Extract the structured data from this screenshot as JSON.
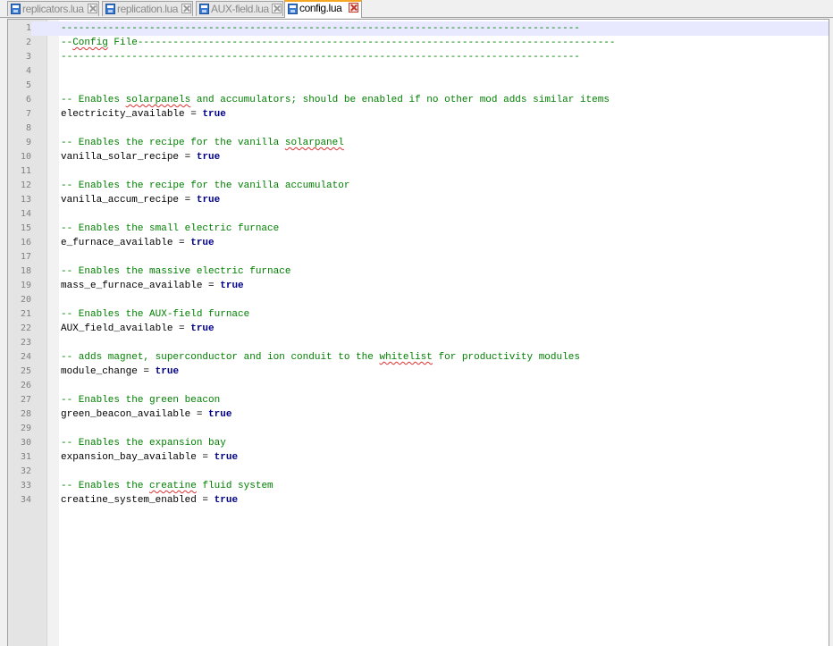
{
  "tabs": [
    {
      "label": "replicators.lua",
      "active": false
    },
    {
      "label": "replication.lua",
      "active": false
    },
    {
      "label": "AUX-field.lua",
      "active": false
    },
    {
      "label": "config.lua",
      "active": true
    }
  ],
  "editor": {
    "current_line": 1,
    "lines": [
      {
        "n": "1",
        "type": "comment",
        "text": "----------------------------------------------------------------------------------------"
      },
      {
        "n": "2",
        "type": "comment",
        "pre": "--",
        "spell": "Config",
        "post": " File---------------------------------------------------------------------------------"
      },
      {
        "n": "3",
        "type": "comment",
        "text": "----------------------------------------------------------------------------------------"
      },
      {
        "n": "4",
        "type": "blank"
      },
      {
        "n": "5",
        "type": "blank"
      },
      {
        "n": "6",
        "type": "comment",
        "pre": "-- Enables ",
        "spell": "solarpanels",
        "post": " and accumulators; should be enabled if no other mod adds similar items"
      },
      {
        "n": "7",
        "type": "assign",
        "name": "electricity_available",
        "op": " = ",
        "value": "true"
      },
      {
        "n": "8",
        "type": "blank"
      },
      {
        "n": "9",
        "type": "comment",
        "pre": "-- Enables the recipe for the vanilla ",
        "spell": "solarpanel",
        "post": ""
      },
      {
        "n": "10",
        "type": "assign",
        "name": "vanilla_solar_recipe",
        "op": " = ",
        "value": "true"
      },
      {
        "n": "11",
        "type": "blank"
      },
      {
        "n": "12",
        "type": "comment",
        "text": "-- Enables the recipe for the vanilla accumulator"
      },
      {
        "n": "13",
        "type": "assign",
        "name": "vanilla_accum_recipe",
        "op": " = ",
        "value": "true"
      },
      {
        "n": "14",
        "type": "blank"
      },
      {
        "n": "15",
        "type": "comment",
        "text": "-- Enables the small electric furnace"
      },
      {
        "n": "16",
        "type": "assign",
        "name": "e_furnace_available",
        "op": " = ",
        "value": "true"
      },
      {
        "n": "17",
        "type": "blank"
      },
      {
        "n": "18",
        "type": "comment",
        "text": "-- Enables the massive electric furnace"
      },
      {
        "n": "19",
        "type": "assign",
        "name": "mass_e_furnace_available",
        "op": " = ",
        "value": "true"
      },
      {
        "n": "20",
        "type": "blank"
      },
      {
        "n": "21",
        "type": "comment",
        "text": "-- Enables the AUX-field furnace"
      },
      {
        "n": "22",
        "type": "assign",
        "name": "AUX_field_available",
        "op": " = ",
        "value": "true"
      },
      {
        "n": "23",
        "type": "blank"
      },
      {
        "n": "24",
        "type": "comment",
        "pre": "-- adds magnet, superconductor and ion conduit to the ",
        "spell": "whitelist",
        "post": " for productivity modules"
      },
      {
        "n": "25",
        "type": "assign",
        "name": "module_change",
        "op": " = ",
        "value": "true"
      },
      {
        "n": "26",
        "type": "blank"
      },
      {
        "n": "27",
        "type": "comment",
        "text": "-- Enables the green beacon"
      },
      {
        "n": "28",
        "type": "assign",
        "name": "green_beacon_available",
        "op": " = ",
        "value": "true"
      },
      {
        "n": "29",
        "type": "blank"
      },
      {
        "n": "30",
        "type": "comment",
        "text": "-- Enables the expansion bay"
      },
      {
        "n": "31",
        "type": "assign",
        "name": "expansion_bay_available",
        "op": " = ",
        "value": "true"
      },
      {
        "n": "32",
        "type": "blank"
      },
      {
        "n": "33",
        "type": "comment",
        "pre": "-- Enables the ",
        "spell": "creatine",
        "post": " fluid system"
      },
      {
        "n": "34",
        "type": "assign",
        "name": "creatine_system_enabled",
        "op": " = ",
        "value": "true"
      }
    ]
  },
  "colors": {
    "comment": "#008000",
    "keyword": "#00008b",
    "current_line_bg": "#e8e8ff",
    "active_tab_accent": "#f5a623"
  },
  "icons": {
    "tab_file": "save-disk-icon",
    "tab_close": "close-icon"
  }
}
